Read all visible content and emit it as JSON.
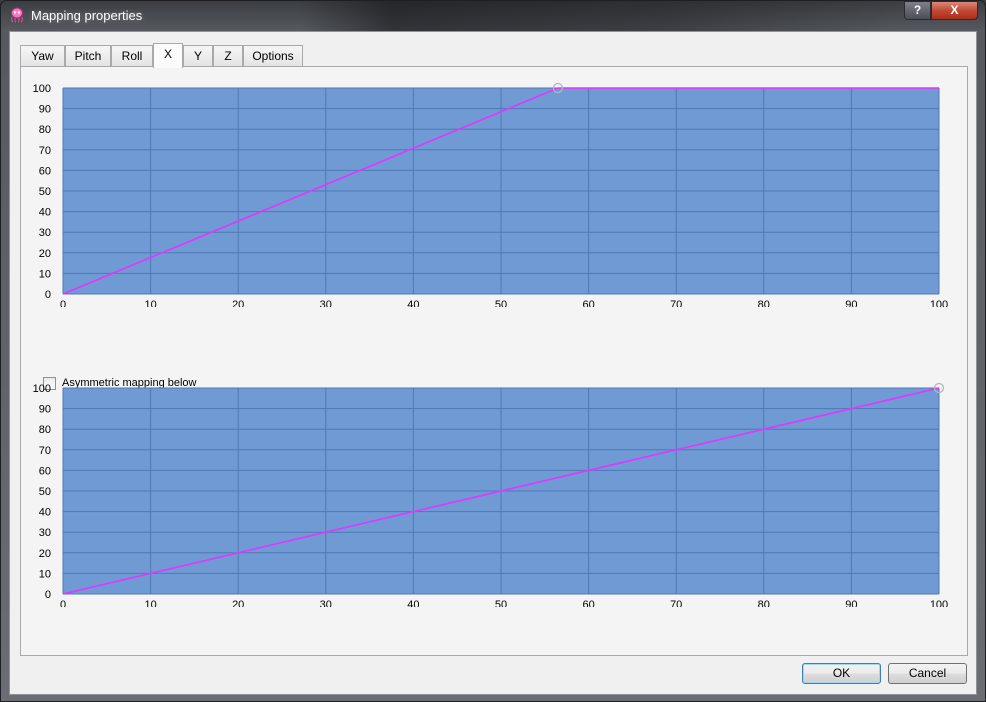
{
  "window": {
    "title": "Mapping properties",
    "help_label": "?",
    "close_label": "X",
    "app_icon": "pink-octopus-icon"
  },
  "tabs": [
    {
      "label": "Yaw",
      "active": false
    },
    {
      "label": "Pitch",
      "active": false
    },
    {
      "label": "Roll",
      "active": false
    },
    {
      "label": "X",
      "active": true
    },
    {
      "label": "Y",
      "active": false
    },
    {
      "label": "Z",
      "active": false
    },
    {
      "label": "Options",
      "active": false
    }
  ],
  "colors": {
    "plot_background": "#6f9ad4",
    "grid": "#4f79b5",
    "curve": "#e534ff",
    "handle": "#b5b5c0"
  },
  "curves": [
    {
      "id": "upper",
      "chart_data": {
        "type": "line",
        "x_ticks": [
          0,
          10,
          20,
          30,
          40,
          50,
          60,
          70,
          80,
          90,
          100
        ],
        "y_ticks": [
          0,
          10,
          20,
          30,
          40,
          50,
          60,
          70,
          80,
          90,
          100
        ],
        "xlim": [
          0,
          100
        ],
        "ylim": [
          0,
          100
        ],
        "grid": true,
        "points": [
          {
            "x": 0,
            "y": 0
          },
          {
            "x": 56.5,
            "y": 100
          },
          {
            "x": 100,
            "y": 100
          }
        ],
        "handles": [
          {
            "x": 56.5,
            "y": 100
          }
        ]
      }
    },
    {
      "id": "lower",
      "chart_data": {
        "type": "line",
        "x_ticks": [
          0,
          10,
          20,
          30,
          40,
          50,
          60,
          70,
          80,
          90,
          100
        ],
        "y_ticks": [
          0,
          10,
          20,
          30,
          40,
          50,
          60,
          70,
          80,
          90,
          100
        ],
        "xlim": [
          0,
          100
        ],
        "ylim": [
          0,
          100
        ],
        "grid": true,
        "points": [
          {
            "x": 0,
            "y": 0
          },
          {
            "x": 100,
            "y": 100
          }
        ],
        "handles": [
          {
            "x": 100,
            "y": 100
          }
        ]
      }
    }
  ],
  "asymmetric": {
    "label": "Asymmetric mapping below",
    "checked": false
  },
  "buttons": {
    "ok": "OK",
    "cancel": "Cancel"
  }
}
